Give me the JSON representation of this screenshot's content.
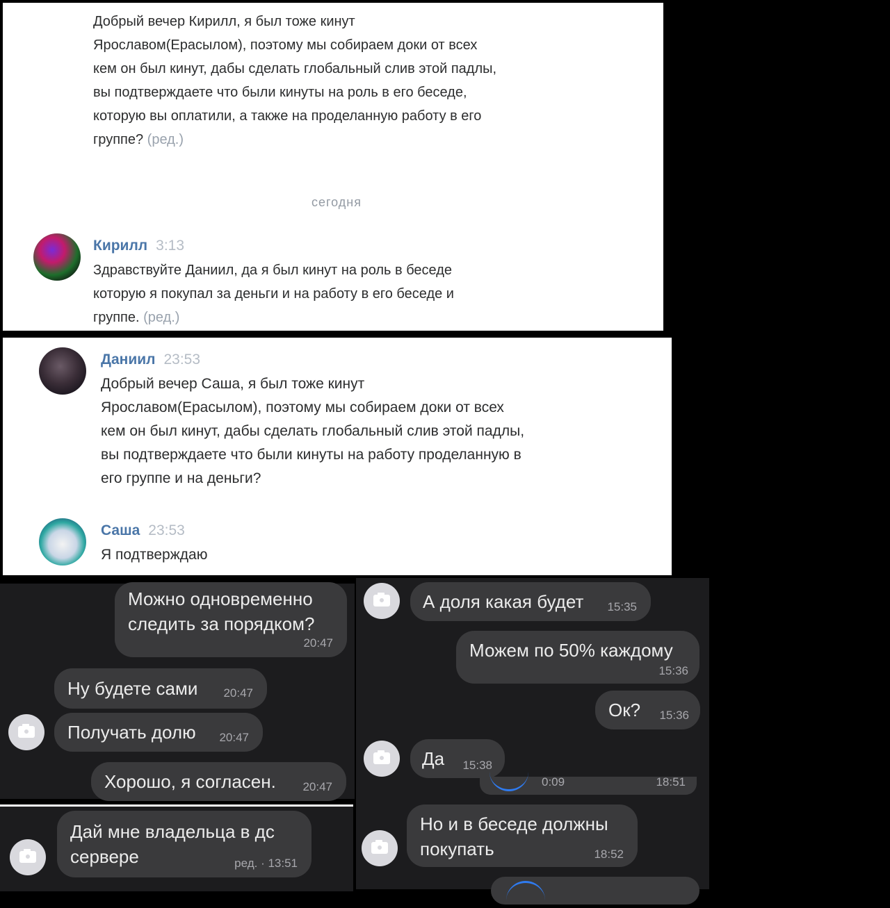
{
  "top_chat": {
    "msg1_lines": [
      "Добрый вечер Кирилл, я был тоже кинут",
      "Ярославом(Ерасылом), поэтому мы собираем доки от всех",
      "кем он был кинут, дабы сделать глобальный слив этой падлы,",
      "вы подтверждаете что были кинуты на роль в его беседе,",
      "которую вы оплатили, а также на проделанную работу в его",
      "группе?"
    ],
    "edited_label": "(ред.)",
    "date_separator": "сегодня",
    "reply": {
      "name": "Кирилл",
      "time": "3:13",
      "lines": [
        "Здравствуйте Даниил, да я был кинут на роль в беседе",
        "которую я покупал за деньги и на работу в его беседе и",
        "группе."
      ]
    }
  },
  "second_chat": {
    "msg": {
      "name": "Даниил",
      "time": "23:53",
      "lines": [
        "Добрый вечер Саша, я был тоже кинут",
        "Ярославом(Ерасылом), поэтому мы собираем доки от всех",
        "кем он был кинут, дабы сделать глобальный слив этой падлы,",
        "вы подтверждаете что были кинуты на работу проделанную в",
        "его группе и на деньги?"
      ]
    },
    "reply": {
      "name": "Саша",
      "time": "23:53",
      "text": "Я подтверждаю"
    }
  },
  "dark_left": {
    "b1": {
      "lines": [
        "Можно одновременно",
        "следить за порядком?"
      ],
      "time": "20:47"
    },
    "b2": {
      "text": "Ну будете сами",
      "time": "20:47"
    },
    "b3": {
      "text": "Получать долю",
      "time": "20:47"
    },
    "b4": {
      "text": "Хорошо, я согласен.",
      "time": "20:47"
    },
    "b5": {
      "lines": [
        "Дай мне владельца в дс",
        "сервере"
      ],
      "time": "ред. · 13:51"
    }
  },
  "dark_right": {
    "b1": {
      "text": "А доля какая будет",
      "time": "15:35"
    },
    "b2": {
      "text": "Можем по 50% каждому",
      "time": "15:36"
    },
    "b3": {
      "text": "Ок?",
      "time": "15:36"
    },
    "b4": {
      "text": "Да",
      "time": "15:38"
    },
    "voice": {
      "duration": "0:09",
      "time": "18:51"
    },
    "b5": {
      "lines": [
        "Но и в беседе должны",
        "покупать"
      ],
      "time": "18:52"
    }
  },
  "icons": [
    "camera-icon"
  ],
  "colors": {
    "vk_name": "#4a76a8",
    "bubble": "#3a3a3c",
    "dark_bg": "#1c1c1e"
  }
}
